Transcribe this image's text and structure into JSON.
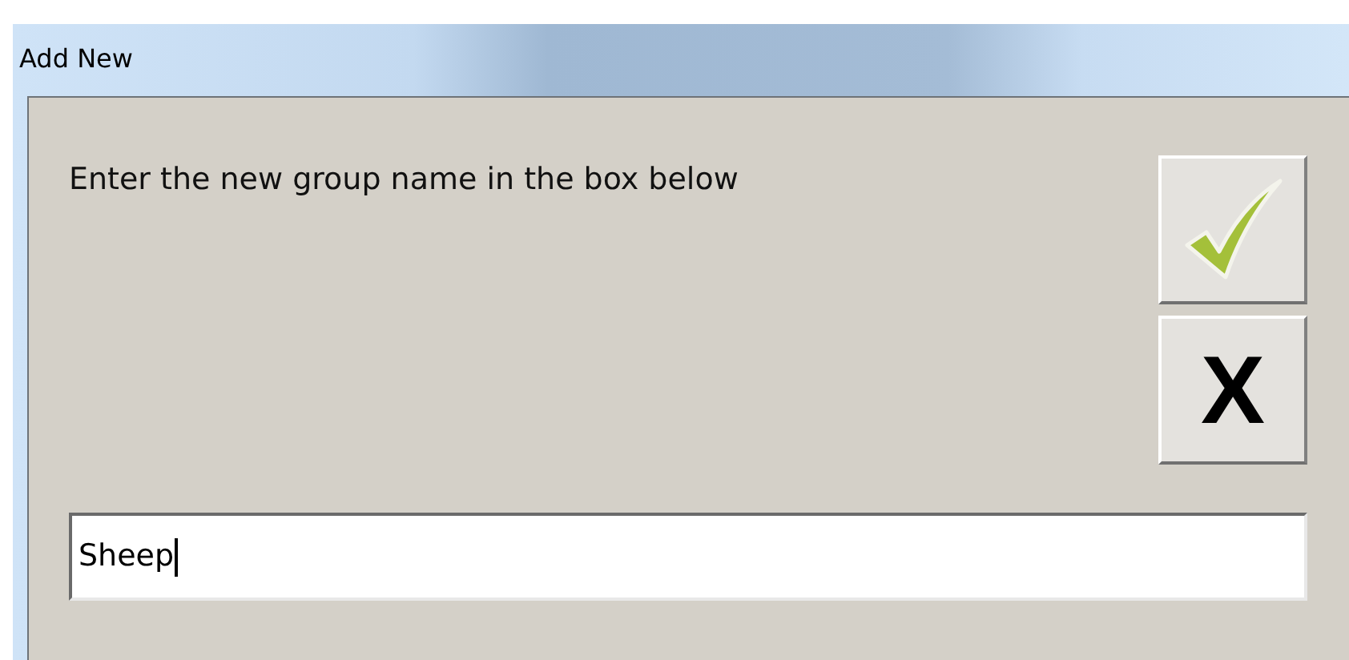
{
  "window": {
    "title": "Add New"
  },
  "prompt": "Enter the new group name in the box below",
  "buttons": [
    {
      "kind": "ok"
    },
    {
      "kind": "cancel",
      "label": "X"
    }
  ],
  "name_field": {
    "value": "Sheep"
  }
}
